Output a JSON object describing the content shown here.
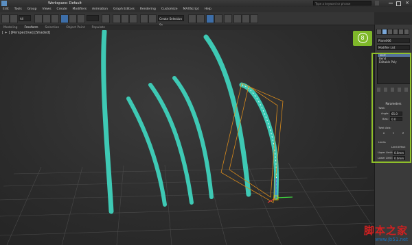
{
  "window": {
    "title": "Workspace: Default",
    "search_placeholder": "Type a keyword or phrase"
  },
  "menu": [
    "Edit",
    "Tools",
    "Group",
    "Views",
    "Create",
    "Modifiers",
    "Animation",
    "Graph Editors",
    "Rendering",
    "Customize",
    "MAXScript",
    "Help"
  ],
  "toolbar": {
    "selection_filter": "All",
    "selection_set": "Create Selection Se"
  },
  "ribbon": {
    "tabs": [
      "Modeling",
      "Freeform",
      "Selection",
      "Object Paint",
      "Populate"
    ],
    "active_tab": "Freeform"
  },
  "viewport": {
    "label": "[ + ] [Perspective] [Shaded]"
  },
  "command_panel": {
    "object_name": "Plane006",
    "modifier_list": "Modifier List",
    "stack": [
      "Twist",
      "Bend",
      "Editable Poly"
    ],
    "rollout_title": "Parameters",
    "twist_label": "Twist:",
    "angle_label": "Angle:",
    "angle_value": "65.0",
    "bias_label": "Bias:",
    "bias_value": "0.0",
    "axis_label": "Twist Axis:",
    "axis_options": [
      "X",
      "Y",
      "Z"
    ],
    "limits_label": "Limits",
    "limit_effect_label": "Limit Effect",
    "upper_limit_label": "Upper Limit:",
    "upper_limit_value": "0.0mm",
    "lower_limit_label": "Lower Limit:",
    "lower_limit_value": "0.0mm"
  },
  "step_badge": "8",
  "watermark": {
    "main": "脚本之家",
    "url": "www.jb51.net"
  },
  "colors": {
    "blade": "#3ec9b4",
    "highlight": "#8fbf2a",
    "gizmo": "#d88a1c"
  }
}
